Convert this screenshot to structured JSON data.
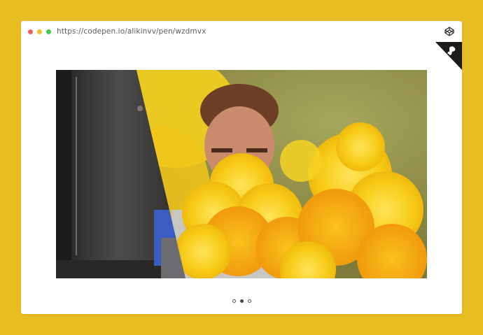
{
  "browser": {
    "url": "https://codepen.io/alikinvv/pen/wzdmvx",
    "traffic_lights": [
      "close",
      "minimize",
      "zoom"
    ],
    "brand_icon": "codepen-icon"
  },
  "corner_badge": {
    "icon": "fork-ribbon-icon"
  },
  "slider": {
    "image": "man-in-yellow-smoke-photo",
    "slides_total": 3,
    "active_slide": 2
  },
  "colors": {
    "page_bg": "#e8bd22",
    "window_bg": "#ffffff",
    "smoke_yellow": "#f7d21a",
    "smoke_orange": "#f19a0d"
  }
}
